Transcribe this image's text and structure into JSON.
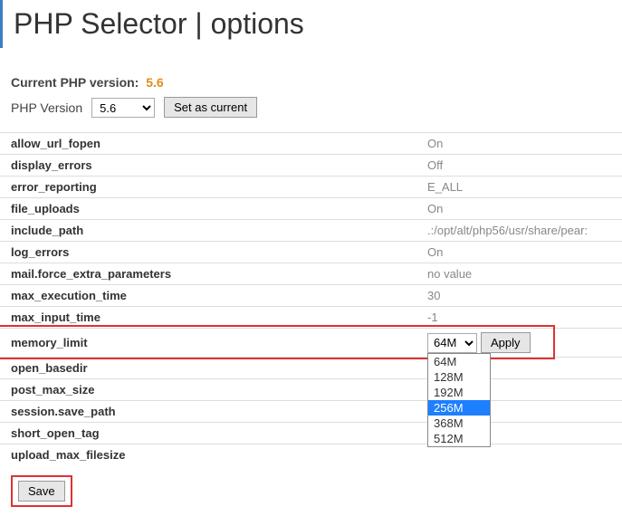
{
  "title": "PHP Selector | options",
  "current_version_label": "Current PHP version:",
  "current_version_value": "5.6",
  "php_version_label": "PHP Version",
  "php_version_selected": "5.6",
  "set_current_btn": "Set as current",
  "options": [
    {
      "name": "allow_url_fopen",
      "value": "On"
    },
    {
      "name": "display_errors",
      "value": "Off"
    },
    {
      "name": "error_reporting",
      "value": "E_ALL"
    },
    {
      "name": "file_uploads",
      "value": "On"
    },
    {
      "name": "include_path",
      "value": ".:/opt/alt/php56/usr/share/pear:"
    },
    {
      "name": "log_errors",
      "value": "On"
    },
    {
      "name": "mail.force_extra_parameters",
      "value": "no value"
    },
    {
      "name": "max_execution_time",
      "value": "30"
    },
    {
      "name": "max_input_time",
      "value": "-1"
    }
  ],
  "memory_row": {
    "name": "memory_limit",
    "selected": "64M",
    "apply_btn": "Apply"
  },
  "options_after": [
    {
      "name": "open_basedir",
      "value": ""
    },
    {
      "name": "post_max_size",
      "value": ""
    },
    {
      "name": "session.save_path",
      "value": ""
    },
    {
      "name": "short_open_tag",
      "value": ""
    },
    {
      "name": "upload_max_filesize",
      "value": ""
    }
  ],
  "dropdown_options": [
    "64M",
    "128M",
    "192M",
    "256M",
    "368M",
    "512M"
  ],
  "dropdown_highlight": "256M",
  "save_btn": "Save"
}
